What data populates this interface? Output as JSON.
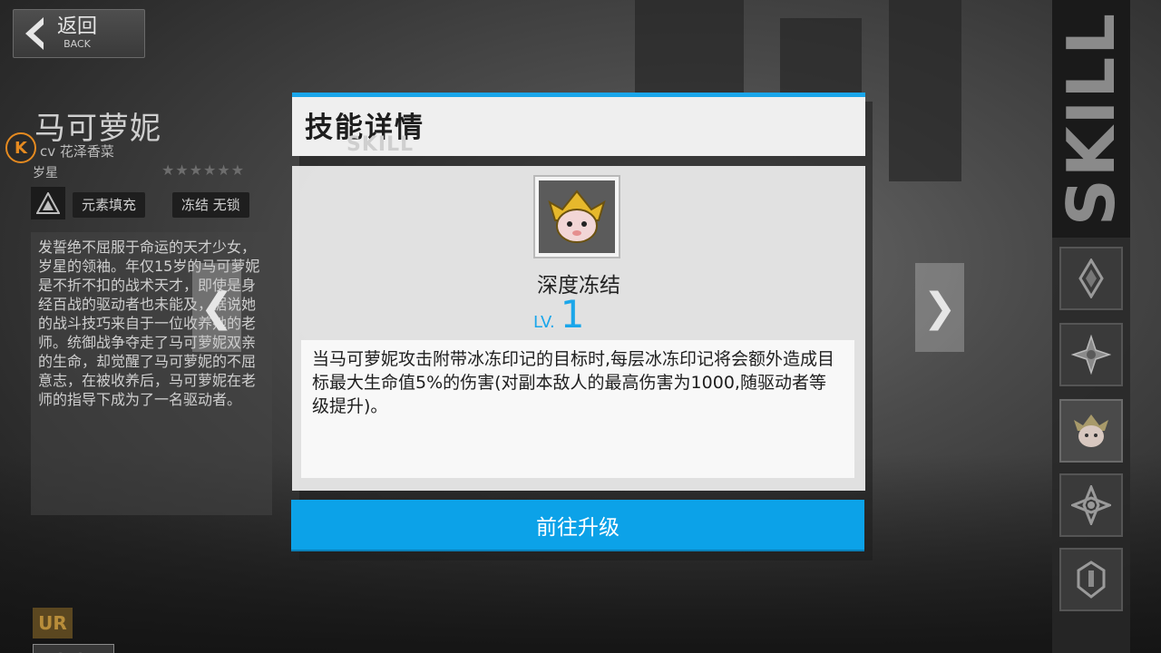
{
  "back": {
    "label_zh": "返回",
    "label_en": "BACK"
  },
  "character": {
    "name": "马可萝妮",
    "cv": "cv 花泽香菜",
    "faction": "岁星",
    "stars": "★★★★★★",
    "tags": [
      "元素填充",
      "冻结 无锁"
    ],
    "description": "发誓绝不屈服于命运的天才少女，岁星的领袖。年仅15岁的马可萝妮是不折不扣的战术天才，即使是身经百战的驱动者也未能及，据说她的战斗技巧来自于一位收养她的老师。统御战争夺走了马可萝妮双亲的生命，却觉醒了马可萝妮的不屈意志，在被收养后，马可萝妮在老师的指导下成为了一名驱动者。",
    "rarity": "UR",
    "rank": "卓越"
  },
  "nav": {
    "prev": "❮",
    "next": "❯"
  },
  "sidebar": {
    "banner": "SKILL",
    "slot_count": 5,
    "active_slot": 2
  },
  "modal": {
    "title": "技能详情",
    "subtitle": "SKILL",
    "skill_name": "深度冻结",
    "level_prefix": "LV.",
    "level": "1",
    "description": "当马可萝妮攻击附带冰冻印记的目标时,每层冰冻印记将会额外造成目标最大生命值5%的伤害(对副本敌人的最高伤害为1000,随驱动者等级提升)。",
    "button": "前往升级"
  },
  "colors": {
    "accent": "#1aa6ea",
    "button": "#0ca2e8",
    "k_badge": "#e58a20"
  }
}
